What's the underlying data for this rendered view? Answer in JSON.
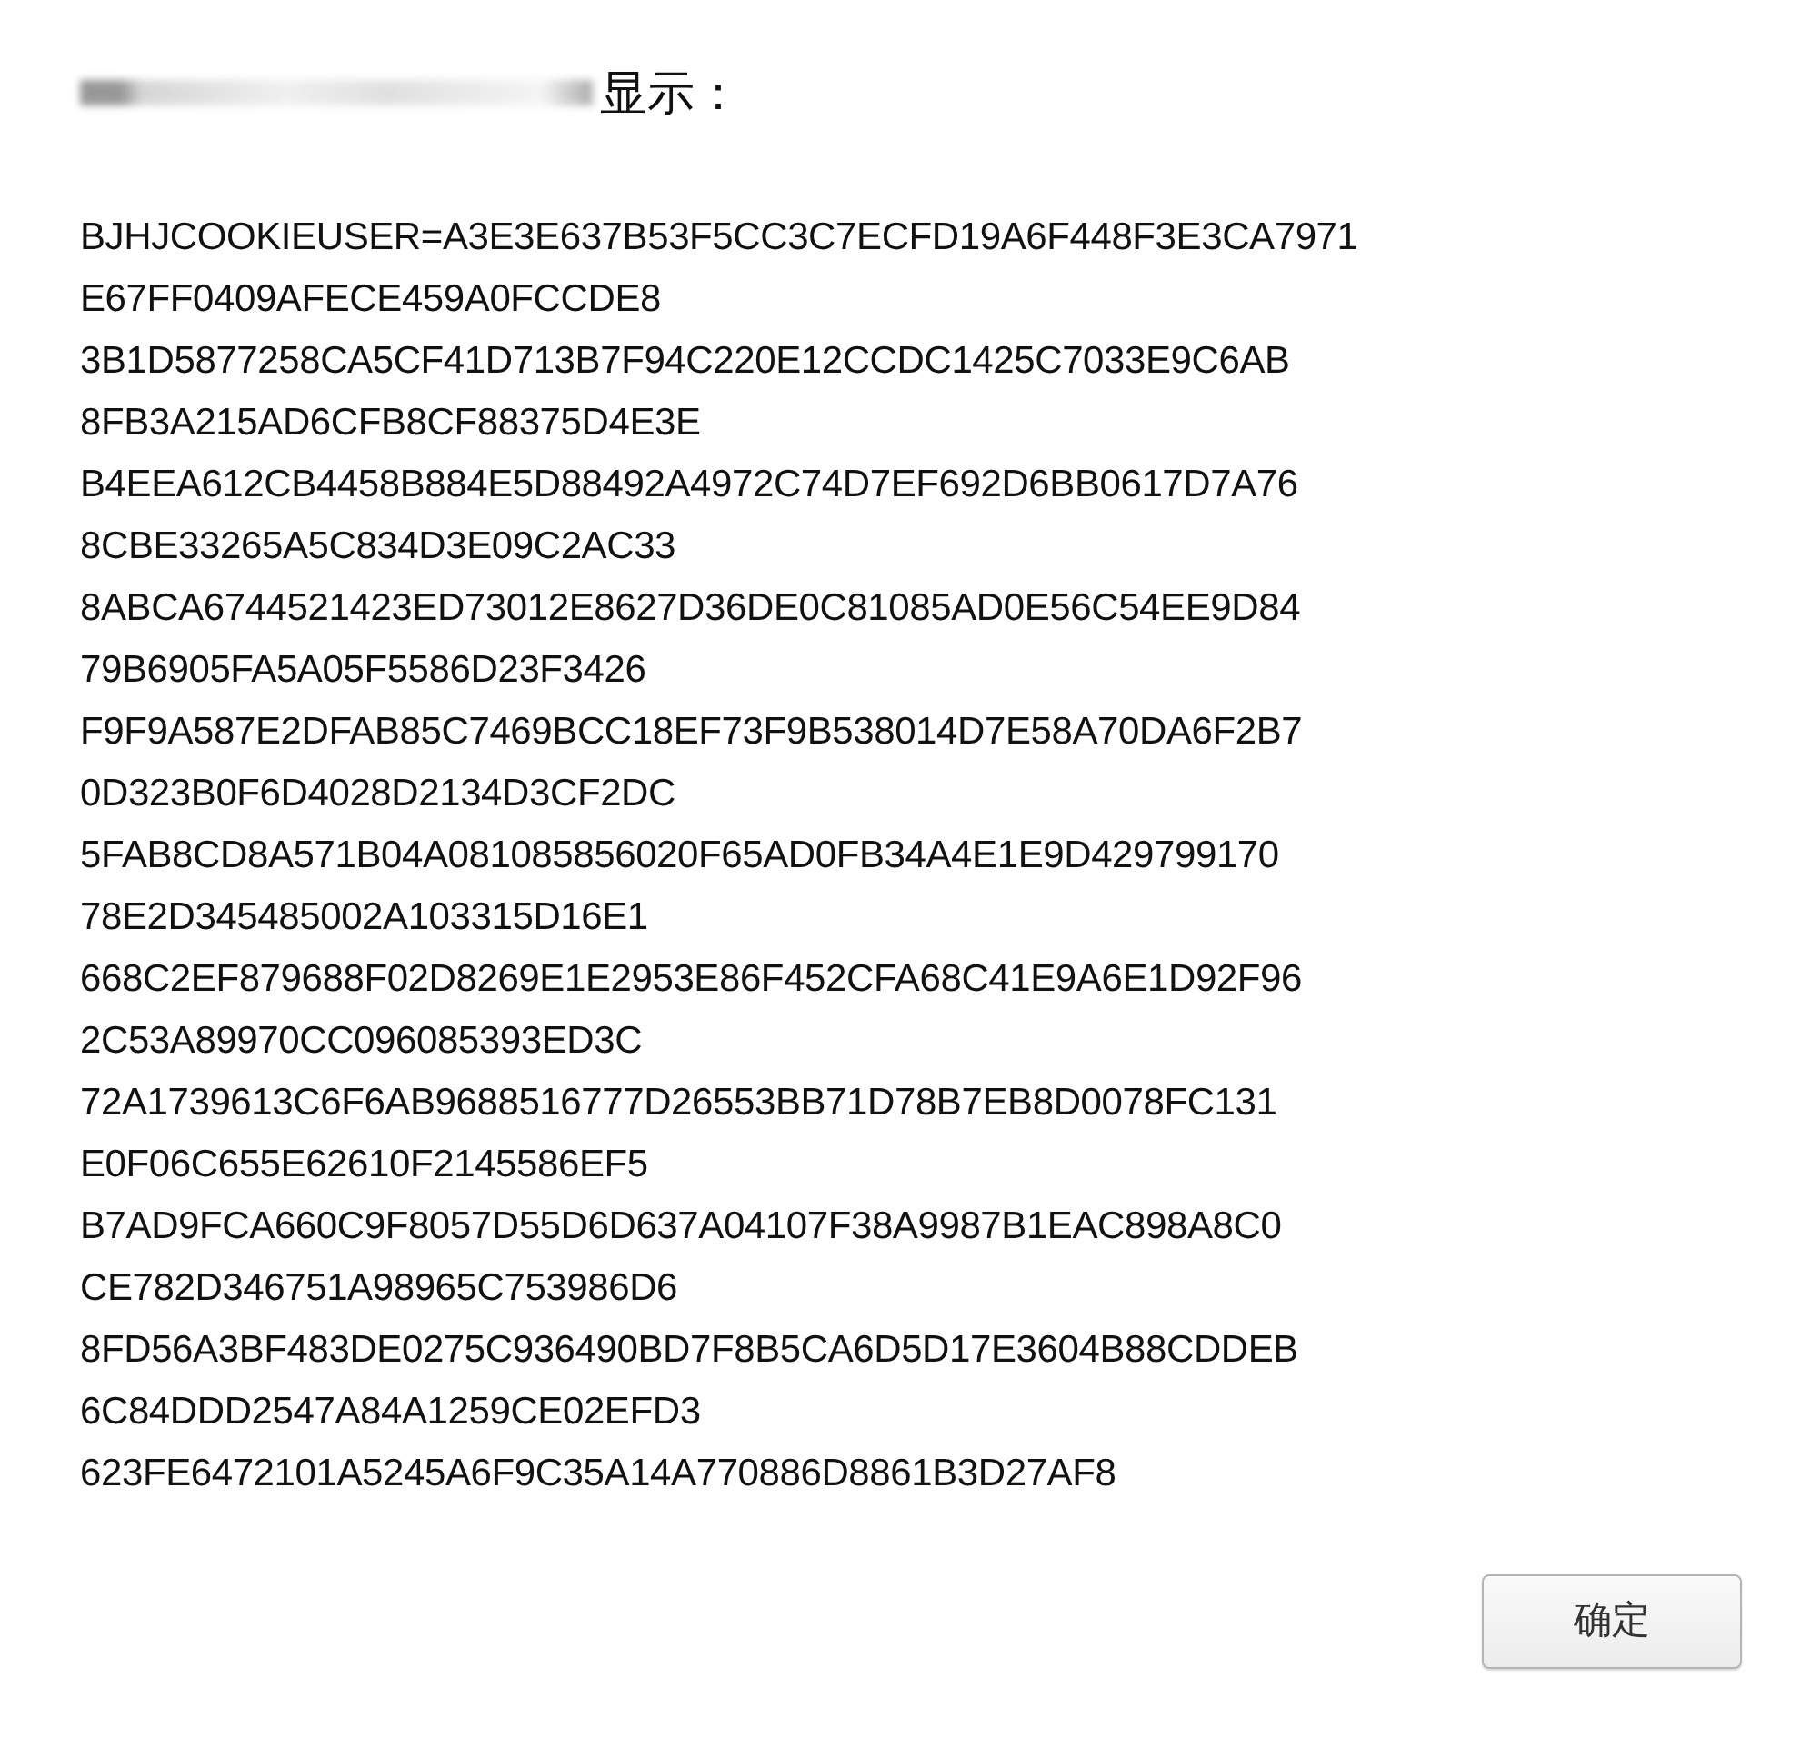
{
  "dialog": {
    "title": "显示：",
    "message_lines": [
      "BJHJCOOKIEUSER=A3E3E637B53F5CC3C7ECFD19A6F448F3E3CA7971",
      "E67FF0409AFECE459A0FCCDE8",
      "3B1D5877258CA5CF41D713B7F94C220E12CCDC1425C7033E9C6AB",
      "8FB3A215AD6CFB8CF88375D4E3E",
      "B4EEA612CB4458B884E5D88492A4972C74D7EF692D6BB0617D7A76",
      "8CBE33265A5C834D3E09C2AC33",
      "8ABCA6744521423ED73012E8627D36DE0C81085AD0E56C54EE9D84",
      "79B6905FA5A05F5586D23F3426",
      "F9F9A587E2DFAB85C7469BCC18EF73F9B538014D7E58A70DA6F2B7",
      "0D323B0F6D4028D2134D3CF2DC",
      "5FAB8CD8A571B04A081085856020F65AD0FB34A4E1E9D429799170",
      "78E2D345485002A103315D16E1",
      "668C2EF879688F02D8269E1E2953E86F452CFA68C41E9A6E1D92F96",
      "2C53A89970CC096085393ED3C",
      "72A1739613C6F6AB9688516777D26553BB71D78B7EB8D0078FC131",
      "E0F06C655E62610F2145586EF5",
      "B7AD9FCA660C9F8057D55D6D637A04107F38A9987B1EAC898A8C0",
      "CE782D346751A98965C753986D6",
      "8FD56A3BF483DE0275C936490BD7F8B5CA6D5D17E3604B88CDDEB",
      "6C84DDD2547A84A1259CE02EFD3",
      "623FE6472101A5245A6F9C35A14A770886D8861B3D27AF8"
    ],
    "buttons": [
      "确定"
    ]
  }
}
